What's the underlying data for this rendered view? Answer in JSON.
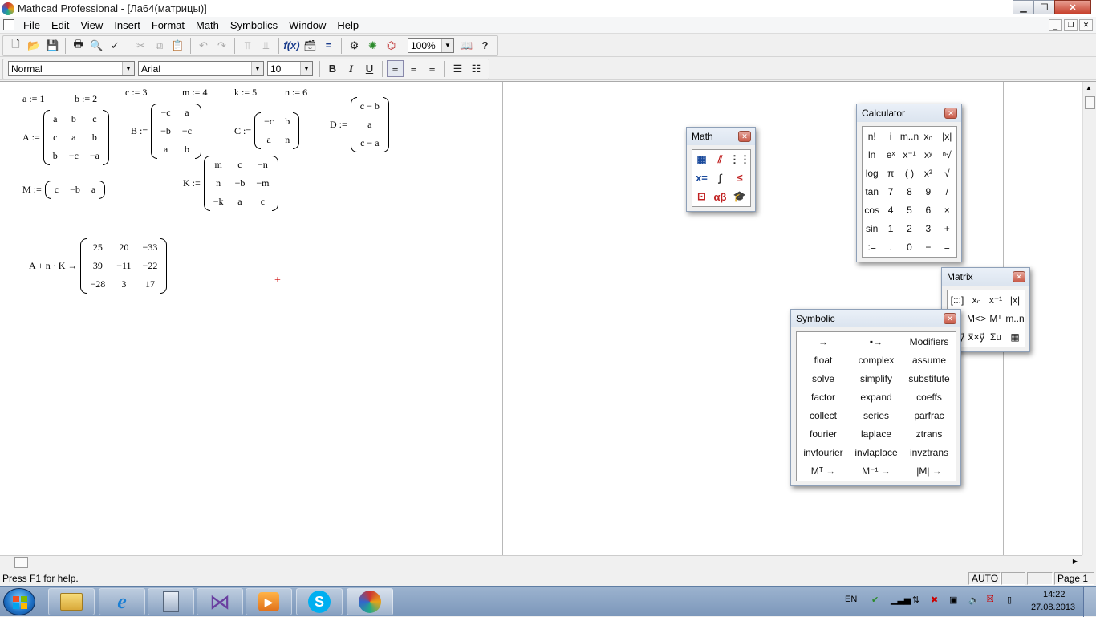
{
  "window": {
    "title": "Mathcad Professional - [Ла64(матрицы)]"
  },
  "menu": [
    "File",
    "Edit",
    "View",
    "Insert",
    "Format",
    "Math",
    "Symbolics",
    "Window",
    "Help"
  ],
  "toolbar": {
    "zoom": "100%"
  },
  "format_bar": {
    "style": "Normal",
    "font": "Arial",
    "size": "10",
    "bold": "B",
    "italic": "I",
    "underline": "U"
  },
  "worksheet": {
    "scalars": [
      {
        "name": "a",
        "value": "1"
      },
      {
        "name": "b",
        "value": "2"
      },
      {
        "name": "c",
        "value": "3"
      },
      {
        "name": "m",
        "value": "4"
      },
      {
        "name": "k",
        "value": "5"
      },
      {
        "name": "n",
        "value": "6"
      }
    ],
    "assign_op": ":=",
    "matrices": {
      "A": {
        "label": "A",
        "cols": 3,
        "cells": [
          "a",
          "b",
          "c",
          "c",
          "a",
          "b",
          "b",
          "−c",
          "−a"
        ]
      },
      "B": {
        "label": "B",
        "cols": 2,
        "cells": [
          "−c",
          "a",
          "−b",
          "−c",
          "a",
          "b"
        ]
      },
      "C": {
        "label": "C",
        "cols": 2,
        "cells": [
          "−c",
          "b",
          "a",
          "n"
        ]
      },
      "D": {
        "label": "D",
        "cols": 1,
        "cells": [
          "c − b",
          "a",
          "c − a"
        ]
      },
      "M": {
        "label": "M",
        "cols": 3,
        "cells": [
          "c",
          "−b",
          "a"
        ]
      },
      "K": {
        "label": "K",
        "cols": 3,
        "cells": [
          "m",
          "c",
          "−n",
          "n",
          "−b",
          "−m",
          "−k",
          "a",
          "c"
        ]
      }
    },
    "expression": {
      "lhs": "A + n · K →",
      "cols": 3,
      "cells": [
        "25",
        "20",
        "−33",
        "39",
        "−11",
        "−22",
        "−28",
        "3",
        "17"
      ]
    },
    "cursor": "+"
  },
  "status": {
    "help": "Press F1 for help.",
    "mode": "AUTO",
    "page": "Page 1"
  },
  "palettes": {
    "math": {
      "title": "Math",
      "items": [
        "calculator-icon",
        "graph-icon",
        "matrix-icon",
        "evaluation-icon",
        "calculus-icon",
        "boolean-icon",
        "programming-icon",
        "greek-icon",
        "symbolic-icon"
      ]
    },
    "calculator": {
      "title": "Calculator",
      "items": [
        "n!",
        "i",
        "m..n",
        "xₙ",
        "|x|",
        "ln",
        "eˣ",
        "x⁻¹",
        "xʸ",
        "ⁿ√",
        "log",
        "π",
        "( )",
        "x²",
        "√",
        "tan",
        "7",
        "8",
        "9",
        "/",
        "cos",
        "4",
        "5",
        "6",
        "×",
        "sin",
        "1",
        "2",
        "3",
        "+",
        ":=",
        ".",
        "0",
        "−",
        "="
      ]
    },
    "matrix": {
      "title": "Matrix",
      "items": [
        "[:::]",
        "xₙ",
        "x⁻¹",
        "|x|",
        "M⃗",
        "M<>",
        "Mᵀ",
        "m..n",
        "x⃗·y⃗",
        "x⃗×y⃗",
        "Σu",
        "▦"
      ]
    },
    "symbolic": {
      "title": "Symbolic",
      "items": [
        "→",
        "▪→",
        "Modifiers",
        "float",
        "complex",
        "assume",
        "solve",
        "simplify",
        "substitute",
        "factor",
        "expand",
        "coeffs",
        "collect",
        "series",
        "parfrac",
        "fourier",
        "laplace",
        "ztrans",
        "invfourier",
        "invlaplace",
        "invztrans",
        "Mᵀ →",
        "M⁻¹ →",
        "|M| →"
      ]
    }
  },
  "taskbar": {
    "lang": "EN",
    "time": "14:22",
    "date": "27.08.2013",
    "apps": [
      "explorer",
      "internet-explorer",
      "calculator",
      "visual-studio",
      "media-player",
      "skype",
      "mathcad"
    ]
  },
  "colors": {
    "accent": "#3a6ea5",
    "cursor": "#cc0000",
    "titlebar": "#ffffff",
    "close": "#c7402c"
  }
}
